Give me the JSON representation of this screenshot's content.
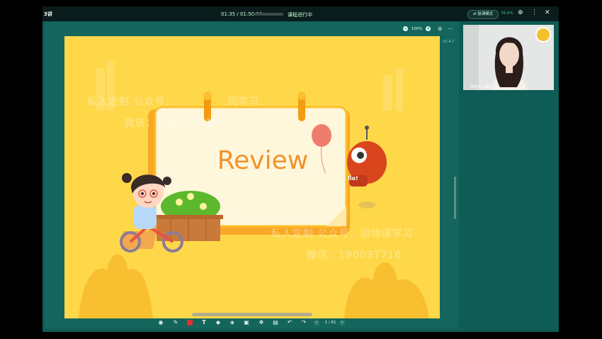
{
  "topbar": {
    "title": "3讲",
    "time": "01:35 / 01:50:00",
    "status": "课程进行中",
    "pill_label": "投课模式",
    "signal": "76.0%"
  },
  "panel": {
    "zoom": "100%",
    "version": "V2.4.7"
  },
  "slide": {
    "title": "Review",
    "hello": "llo!",
    "watermark_1a": "私人定制  公众号：",
    "watermark_1b": "润学习",
    "watermark_2": "微信：190097716",
    "watermark_3": "私人定制  公众号：润物课学习",
    "watermark_4": "微信：190097716"
  },
  "pager": {
    "current": "1",
    "total": "/ 61"
  },
  "video": {
    "name": "熊老师小课堂"
  },
  "colors": {
    "frame": "#0e5c55",
    "slide_bg": "#ffd84a",
    "title_orange": "#f0932b"
  }
}
